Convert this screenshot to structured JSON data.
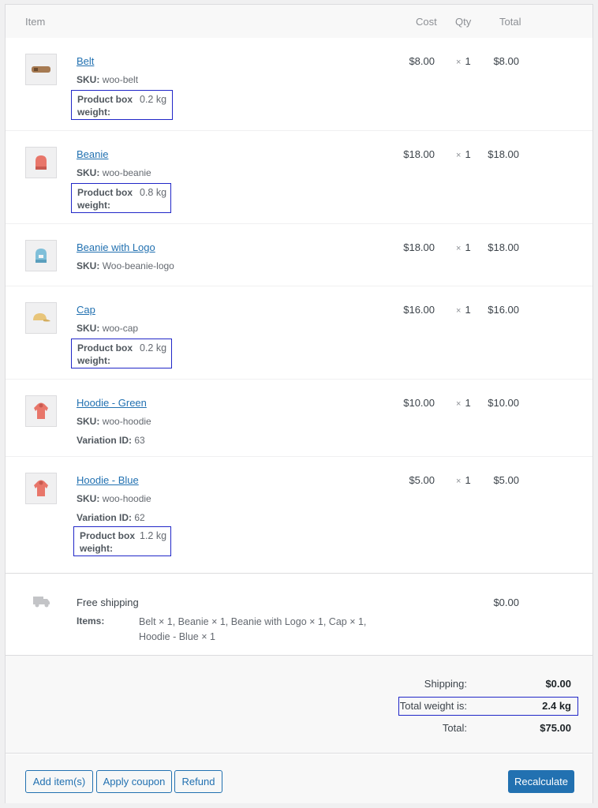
{
  "columns": {
    "item": "Item",
    "cost": "Cost",
    "qty": "Qty",
    "total": "Total"
  },
  "items": [
    {
      "name": "Belt",
      "sku_label": "SKU:",
      "sku": "woo-belt",
      "cost": "$8.00",
      "qty": "1",
      "total": "$8.00",
      "weight_label": "Product box weight:",
      "weight": "0.2 kg",
      "icon": "belt-icon"
    },
    {
      "name": "Beanie",
      "sku_label": "SKU:",
      "sku": "woo-beanie",
      "cost": "$18.00",
      "qty": "1",
      "total": "$18.00",
      "weight_label": "Product box weight:",
      "weight": "0.8 kg",
      "icon": "beanie-icon"
    },
    {
      "name": "Beanie with Logo",
      "sku_label": "SKU:",
      "sku": "Woo-beanie-logo",
      "cost": "$18.00",
      "qty": "1",
      "total": "$18.00",
      "icon": "beanie-logo-icon"
    },
    {
      "name": "Cap",
      "sku_label": "SKU:",
      "sku": "woo-cap",
      "cost": "$16.00",
      "qty": "1",
      "total": "$16.00",
      "weight_label": "Product box weight:",
      "weight": "0.2 kg",
      "icon": "cap-icon"
    },
    {
      "name": "Hoodie - Green",
      "sku_label": "SKU:",
      "sku": "woo-hoodie",
      "variation_label": "Variation ID:",
      "variation": "63",
      "cost": "$10.00",
      "qty": "1",
      "total": "$10.00",
      "icon": "hoodie-icon"
    },
    {
      "name": "Hoodie - Blue",
      "sku_label": "SKU:",
      "sku": "woo-hoodie",
      "variation_label": "Variation ID:",
      "variation": "62",
      "cost": "$5.00",
      "qty": "1",
      "total": "$5.00",
      "weight_label": "Product box weight:",
      "weight": "1.2 kg",
      "icon": "hoodie-icon"
    }
  ],
  "qty_symbol": "×",
  "shipping": {
    "name": "Free shipping",
    "items_label": "Items:",
    "items": "Belt × 1, Beanie × 1, Beanie with Logo × 1, Cap × 1, Hoodie - Blue × 1",
    "total": "$0.00",
    "icon": "truck-icon"
  },
  "totals": {
    "shipping_label": "Shipping:",
    "shipping": "$0.00",
    "weight_label": "Total weight is:",
    "weight": "2.4 kg",
    "total_label": "Total:",
    "total": "$75.00"
  },
  "actions": {
    "add_items": "Add item(s)",
    "apply_coupon": "Apply coupon",
    "refund": "Refund",
    "recalculate": "Recalculate"
  },
  "colors": {
    "link": "#2271b1",
    "highlight": "#2127c8"
  }
}
